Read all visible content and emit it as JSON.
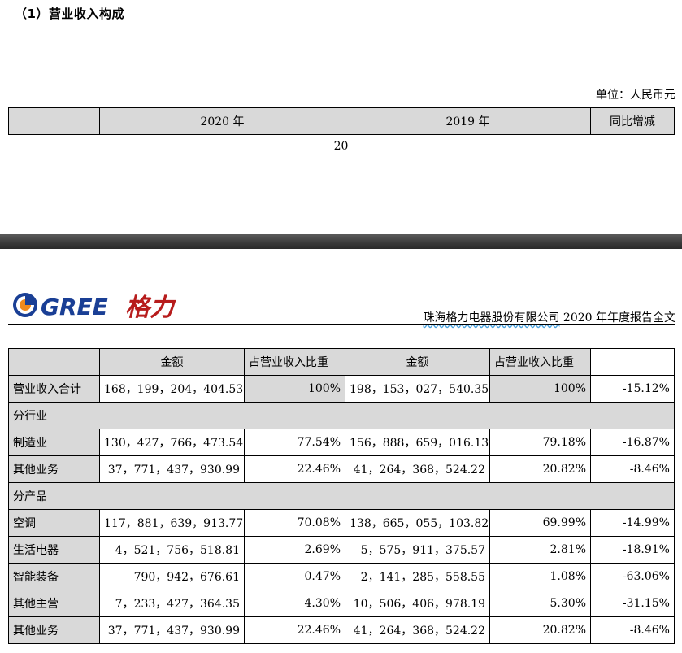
{
  "section_title": "（1）营业收入构成",
  "unit_label": "单位：人民币元",
  "header": {
    "year_2020": "2020 年",
    "year_2019": "2019 年",
    "yoy": "同比增减"
  },
  "page_number": "20",
  "logo": {
    "brand": "GREE",
    "brand_cn": "格力"
  },
  "report_caption": {
    "company": "珠海格力电器股份有限公司",
    "rest": " 2020 年年度报告全文"
  },
  "columns": {
    "amount_2020": "金额",
    "ratio_2020": "占营业收入比重",
    "amount_2019": "金额",
    "ratio_2019": "占营业收入比重"
  },
  "total": {
    "label": "营业收入合计",
    "amount_2020": "168，199，204，404.53",
    "ratio_2020": "100%",
    "amount_2019": "198，153，027，540.35",
    "ratio_2019": "100%",
    "yoy": "-15.12%"
  },
  "by_industry": {
    "heading": "分行业",
    "rows": [
      {
        "label": "制造业",
        "amount_2020": "130，427，766，473.54",
        "ratio_2020": "77.54%",
        "amount_2019": "156，888，659，016.13",
        "ratio_2019": "79.18%",
        "yoy": "-16.87%"
      },
      {
        "label": "其他业务",
        "amount_2020": "37，771，437，930.99",
        "ratio_2020": "22.46%",
        "amount_2019": "41，264，368，524.22",
        "ratio_2019": "20.82%",
        "yoy": "-8.46%"
      }
    ]
  },
  "by_product": {
    "heading": "分产品",
    "rows": [
      {
        "label": "空调",
        "amount_2020": "117，881，639，913.77",
        "ratio_2020": "70.08%",
        "amount_2019": "138，665，055，103.82",
        "ratio_2019": "69.99%",
        "yoy": "-14.99%"
      },
      {
        "label": "生活电器",
        "amount_2020": "4，521，756，518.81",
        "ratio_2020": "2.69%",
        "amount_2019": "5，575，911，375.57",
        "ratio_2019": "2.81%",
        "yoy": "-18.91%"
      },
      {
        "label": "智能装备",
        "amount_2020": "790，942，676.61",
        "ratio_2020": "0.47%",
        "amount_2019": "2，141，285，558.55",
        "ratio_2019": "1.08%",
        "yoy": "-63.06%"
      },
      {
        "label": "其他主营",
        "amount_2020": "7，233，427，364.35",
        "ratio_2020": "4.30%",
        "amount_2019": "10，506，406，978.19",
        "ratio_2019": "5.30%",
        "yoy": "-31.15%"
      },
      {
        "label": "其他业务",
        "amount_2020": "37，771，437，930.99",
        "ratio_2020": "22.46%",
        "amount_2019": "41，264，368，524.22",
        "ratio_2019": "20.82%",
        "yoy": "-8.46%"
      }
    ]
  },
  "colors": {
    "header_fill": "#d9d9d9",
    "page_break": "#3a3a3a",
    "logo_blue": "#1a3f95",
    "logo_orange": "#f08a1c",
    "logo_red": "#b71c1c"
  }
}
